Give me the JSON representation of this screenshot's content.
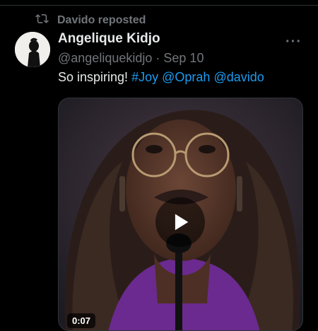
{
  "repost": {
    "icon": "repost-icon",
    "text": "Davido reposted"
  },
  "author": {
    "name": "Angelique Kidjo",
    "handle": "@angeliquekidjo",
    "separator": "·",
    "date": "Sep 10",
    "avatar_icon": "avatar-silhouette"
  },
  "more_label": "···",
  "tweet": {
    "text": "So inspiring!",
    "hashtag": "#Joy",
    "mentions": [
      "@Oprah",
      "@davido"
    ]
  },
  "media": {
    "type": "video",
    "play_icon": "play-icon",
    "duration": "0:07"
  },
  "colors": {
    "background": "#000000",
    "primary_text": "#e7e9ea",
    "secondary_text": "#71767b",
    "link": "#1d9bf0",
    "video_accent": "#6b2a8f"
  }
}
